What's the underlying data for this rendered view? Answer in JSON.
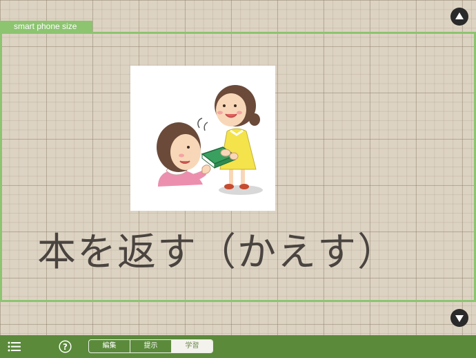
{
  "frame": {
    "label": "smart phone size"
  },
  "card": {
    "image_icon": "girl-returning-book-illustration",
    "text": "本を返す（かえす）"
  },
  "navigation": {
    "up_icon": "triangle-up-icon",
    "down_icon": "triangle-down-icon"
  },
  "toolbar": {
    "menu_icon": "list-icon",
    "help_icon": "question-circle-icon",
    "modes": [
      {
        "label": "編集",
        "active": false
      },
      {
        "label": "提示",
        "active": false
      },
      {
        "label": "学習",
        "active": true
      }
    ]
  },
  "colors": {
    "background": "#ddd3c3",
    "frame_green": "#8cc470",
    "toolbar_green": "#5b8a3b",
    "text": "#4a4440"
  }
}
